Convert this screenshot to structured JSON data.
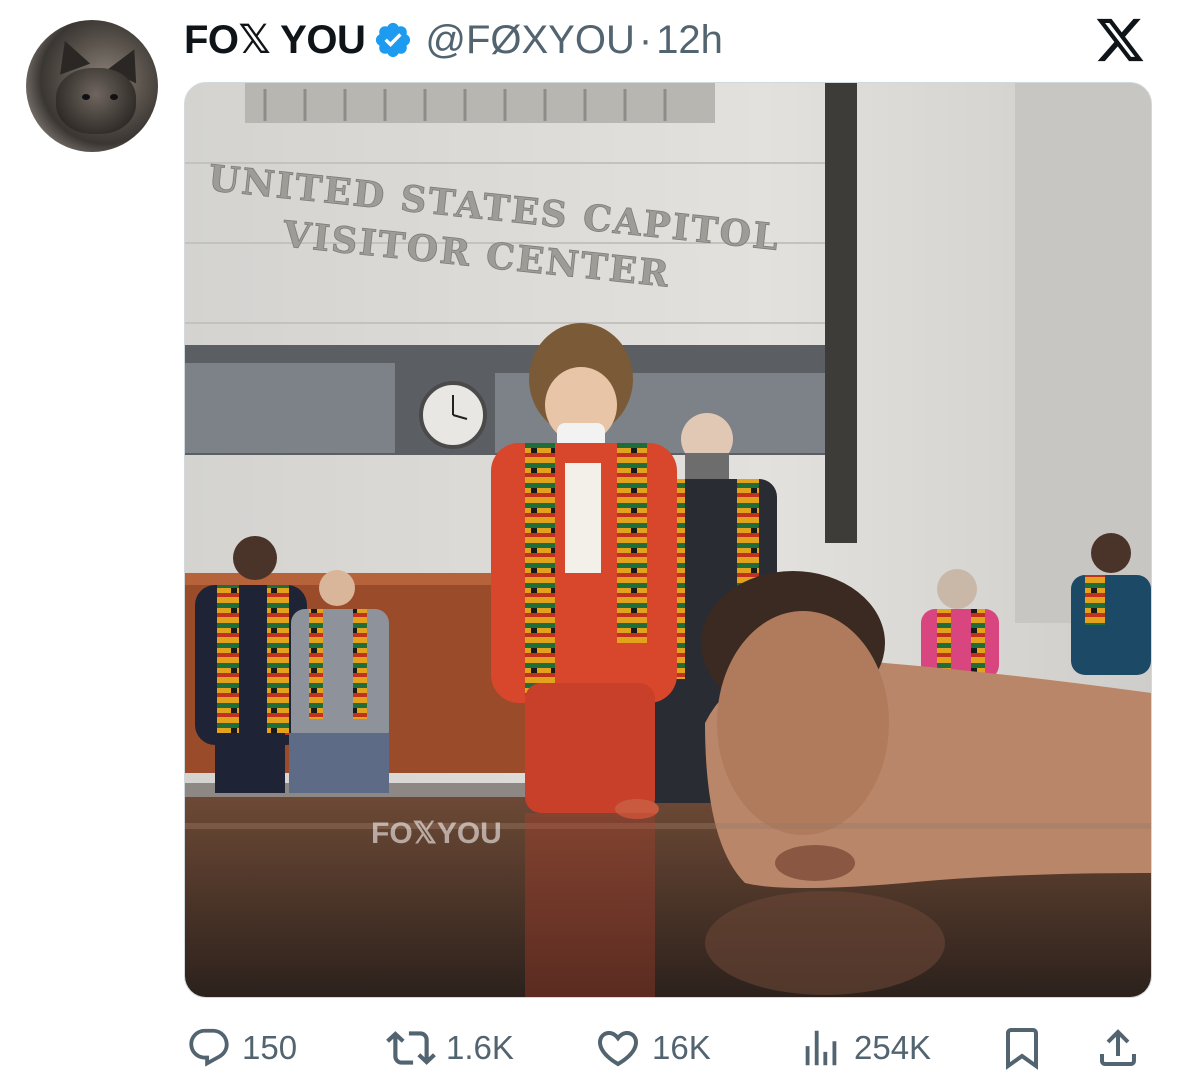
{
  "tweet": {
    "display_name": "FO𝕏 YOU",
    "handle": "@FØXYOU",
    "separator": "·",
    "time": "12h",
    "verified": true,
    "platform_logo": "x-logo-icon"
  },
  "media": {
    "sign_line_1": "UNITED STATES CAPITOL",
    "sign_line_2": "VISITOR CENTER",
    "watermark": "FO𝕏YOU"
  },
  "actions": {
    "replies": {
      "icon": "reply-icon",
      "count": "150"
    },
    "reposts": {
      "icon": "repost-icon",
      "count": "1.6K"
    },
    "likes": {
      "icon": "heart-icon",
      "count": "16K"
    },
    "views": {
      "icon": "views-icon",
      "count": "254K"
    },
    "bookmark": {
      "icon": "bookmark-icon"
    },
    "share": {
      "icon": "share-icon"
    }
  },
  "colors": {
    "verified_blue": "#1d9bf0",
    "secondary_text": "#536471",
    "primary_text": "#0f1419"
  }
}
